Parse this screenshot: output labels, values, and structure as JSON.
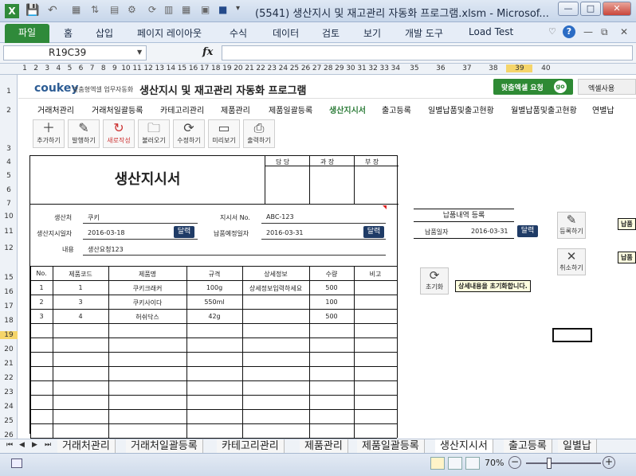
{
  "titlebar": {
    "title": "(5541) 생산지시 및 재고관리 자동화 프로그램.xlsm - Microsof..."
  },
  "ribbon": {
    "file": "파일",
    "tabs": [
      "홈",
      "삽입",
      "페이지 레이아웃",
      "수식",
      "데이터",
      "검토",
      "보기",
      "개발 도구",
      "Load Test"
    ]
  },
  "formula_bar": {
    "name_box": "R19C39",
    "fx": "fx",
    "formula": ""
  },
  "columns": [
    "1",
    "2",
    "3",
    "4",
    "5",
    "6",
    "7",
    "8",
    "9",
    "10",
    "11",
    "12",
    "13",
    "14",
    "15",
    "16",
    "17",
    "18",
    "19",
    "20",
    "21",
    "22",
    "23",
    "24",
    "25",
    "26",
    "27",
    "28",
    "29",
    "30",
    "31",
    "32",
    "33",
    "34",
    "35",
    "36",
    "37",
    "38",
    "39",
    "40"
  ],
  "rows": [
    "1",
    "2",
    "3",
    "4",
    "5",
    "6",
    "7",
    "10",
    "11",
    "12",
    "15",
    "16",
    "17",
    "18",
    "19",
    "20",
    "21",
    "22",
    "23",
    "24",
    "25",
    "26"
  ],
  "header": {
    "logo_main": "coukey",
    "logo_sub": "맞춤형엑셀 업무자동화",
    "program_title": "생산지시 및 재고관리 자동화 프로그램",
    "request_btn": "맞춤엑셀 요청",
    "request_go": "go",
    "excel_use": "엑셀사용"
  },
  "nav": [
    "거래처관리",
    "거래처일괄등록",
    "카테고리관리",
    "제품관리",
    "제품일괄등록",
    "생산지시서",
    "출고등록",
    "일별납품및출고현황",
    "월별납품및출고현황",
    "연별납"
  ],
  "toolbar": [
    "추가하기",
    "발행하기",
    "새로작성",
    "불러오기",
    "수정하기",
    "미리보기",
    "출력하기"
  ],
  "doc": {
    "title": "생산지시서",
    "approval": [
      "담 당",
      "과 장",
      "부 장"
    ],
    "labels": {
      "client": "생산처",
      "date": "생산지시일자",
      "content": "내용",
      "doc_no": "지시서 No.",
      "due": "납품예정일자"
    },
    "values": {
      "client": "쿠키",
      "date": "2016-03-18",
      "content": "생산요청123",
      "doc_no": "ABC-123",
      "due": "2016-03-31"
    },
    "calendar_btn": "달력",
    "table_headers": [
      "No.",
      "제품코드",
      "제품명",
      "규격",
      "상세정보",
      "수량",
      "비고"
    ],
    "rows": [
      [
        "1",
        "1",
        "쿠키크래커",
        "100g",
        "상세정보입력하세요",
        "500",
        ""
      ],
      [
        "2",
        "3",
        "쿠키사이다",
        "550ml",
        "",
        "100",
        ""
      ],
      [
        "3",
        "4",
        "허쉬닥스",
        "42g",
        "",
        "500",
        ""
      ]
    ]
  },
  "side": {
    "reg_title": "납품내역 등록",
    "reg_date_label": "납품일자",
    "reg_date": "2016-03-31",
    "calendar_btn": "달력",
    "register": "등록하기",
    "cancel": "취소하기",
    "reset": "초기화",
    "reset_tip": "상세내용을 초기화합니다.",
    "tip_cut": "납품"
  },
  "sheet_tabs": [
    "거래처관리",
    "거래처일괄등록",
    "카테고리관리",
    "제품관리",
    "제품일괄등록",
    "생산지시서",
    "출고등록",
    "일별납"
  ],
  "status": {
    "zoom": "70%"
  }
}
